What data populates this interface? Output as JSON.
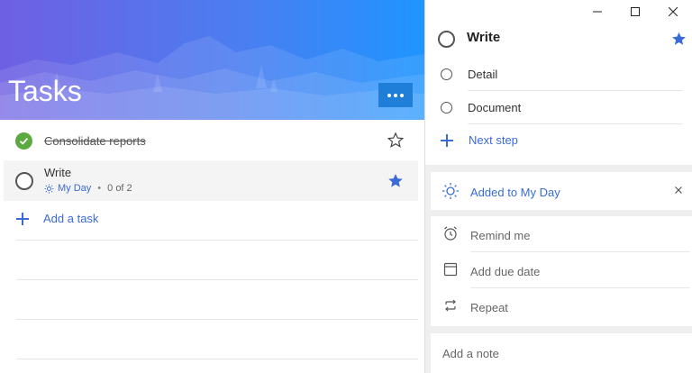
{
  "list": {
    "title": "Tasks",
    "more_label": "more options",
    "tasks": [
      {
        "title": "Consolidate reports",
        "completed": true,
        "important": false
      },
      {
        "title": "Write",
        "completed": false,
        "important": true,
        "meta_myday": "My Day",
        "meta_steps": "0 of 2"
      }
    ],
    "add_task_label": "Add a task"
  },
  "detail": {
    "title": "Write",
    "steps": [
      {
        "label": "Detail"
      },
      {
        "label": "Document"
      }
    ],
    "next_step_label": "Next step",
    "my_day_label": "Added to My Day",
    "remind_label": "Remind me",
    "due_label": "Add due date",
    "repeat_label": "Repeat",
    "note_placeholder": "Add a note"
  },
  "colors": {
    "accent": "#3a6bd8",
    "complete": "#5ca93f",
    "banner_start": "#6f5fe3",
    "banner_end": "#1f95ff"
  },
  "icons": [
    "check-icon",
    "star-outline-icon",
    "star-filled-icon",
    "sun-icon",
    "plus-icon",
    "close-icon",
    "alarm-icon",
    "calendar-icon",
    "repeat-icon",
    "minimize-icon",
    "maximize-icon",
    "window-close-icon"
  ]
}
